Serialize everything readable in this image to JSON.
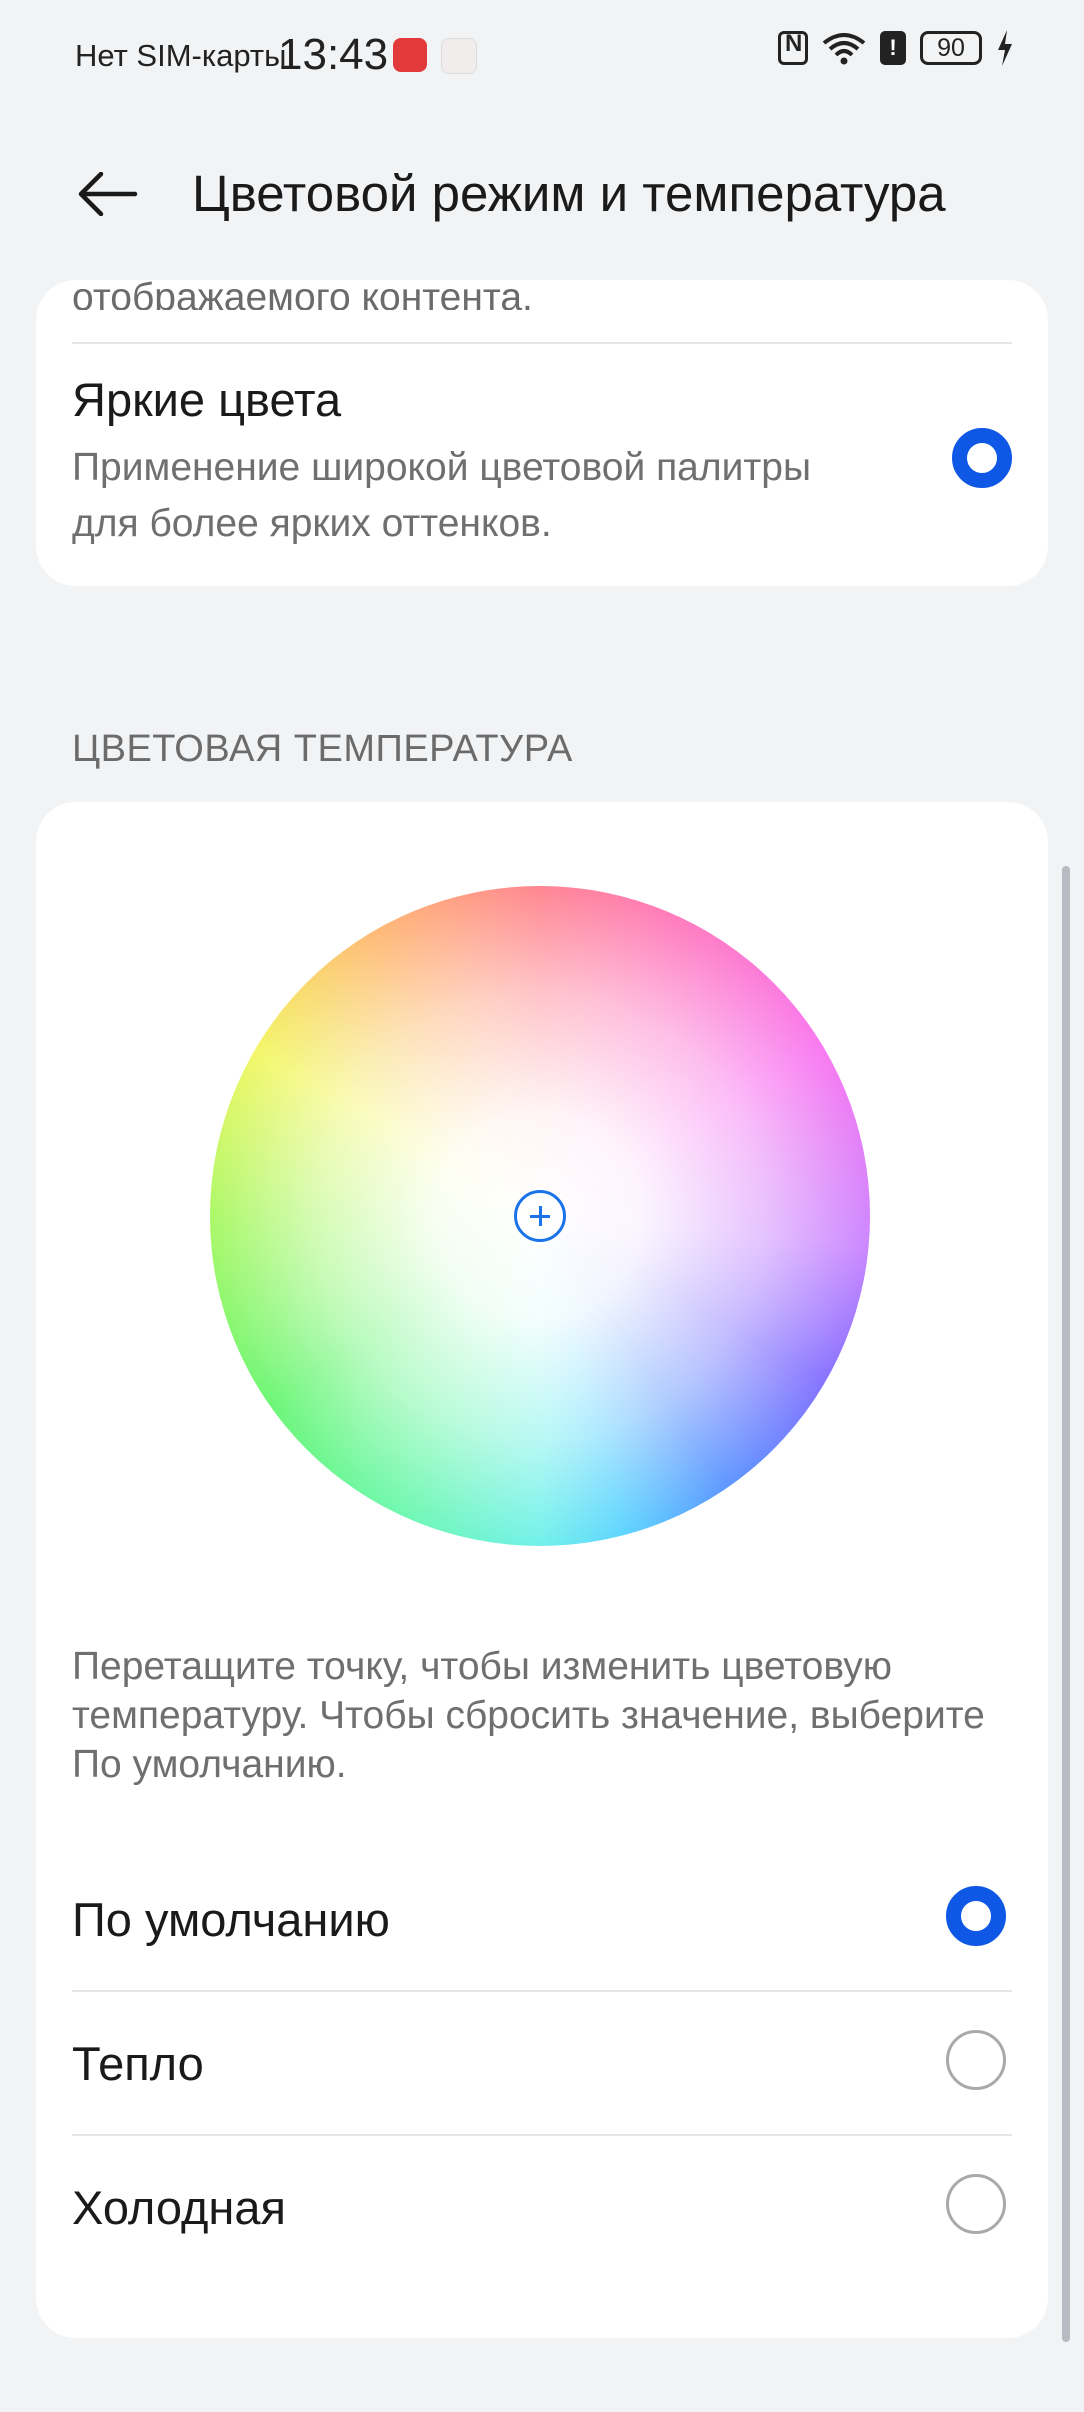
{
  "status_bar": {
    "carrier": "Нет SIM-карты",
    "time": "13:43",
    "battery": "90"
  },
  "header": {
    "title": "Цветовой режим и температура"
  },
  "color_mode": {
    "truncated_text": "отображаемого контента.",
    "vivid": {
      "title": "Яркие цвета",
      "description": "Применение широкой цветовой палитры для более ярких оттенков.",
      "selected": true
    }
  },
  "temperature": {
    "section_title": "ЦВЕТОВАЯ ТЕМПЕРАТУРА",
    "hint": "Перетащите точку, чтобы изменить цветовую температуру. Чтобы сбросить значение, выберите По умолчанию.",
    "options": [
      {
        "label": "По умолчанию",
        "selected": true
      },
      {
        "label": "Тепло",
        "selected": false
      },
      {
        "label": "Холодная",
        "selected": false
      }
    ]
  },
  "colors": {
    "accent": "#0f58e6",
    "background": "#f1f3f5",
    "card": "#ffffff"
  }
}
